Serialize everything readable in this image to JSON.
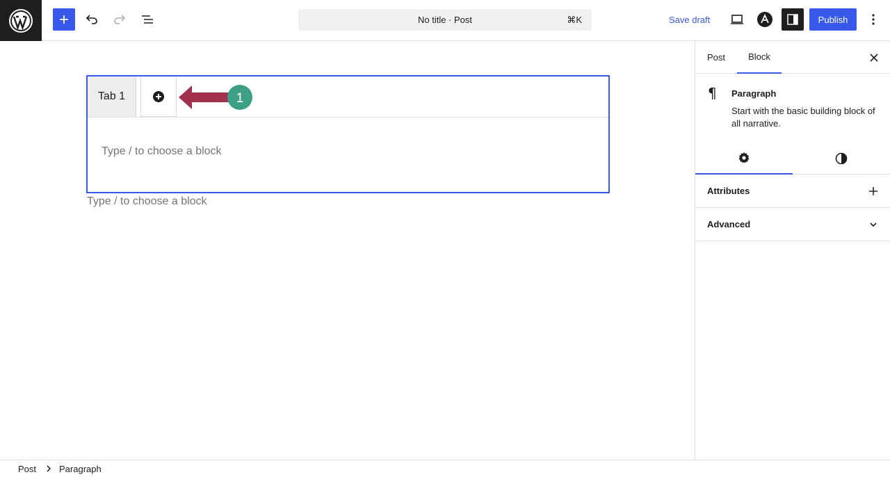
{
  "header": {
    "document_title": "No title · Post",
    "shortcut": "⌘K",
    "save_draft_label": "Save draft",
    "publish_label": "Publish",
    "accent_color": "#3858e9"
  },
  "editor": {
    "tabs": [
      {
        "label": "Tab 1"
      }
    ],
    "inner_placeholder": "Type / to choose a block",
    "outer_placeholder": "Type / to choose a block",
    "annotation_number": "1"
  },
  "sidebar": {
    "tabs": [
      {
        "label": "Post"
      },
      {
        "label": "Block"
      }
    ],
    "active_tab": "Block",
    "block_title": "Paragraph",
    "block_description": "Start with the basic building block of all narrative.",
    "panels": [
      {
        "label": "Attributes"
      },
      {
        "label": "Advanced"
      }
    ]
  },
  "breadcrumb": {
    "items": [
      "Post",
      "Paragraph"
    ]
  }
}
